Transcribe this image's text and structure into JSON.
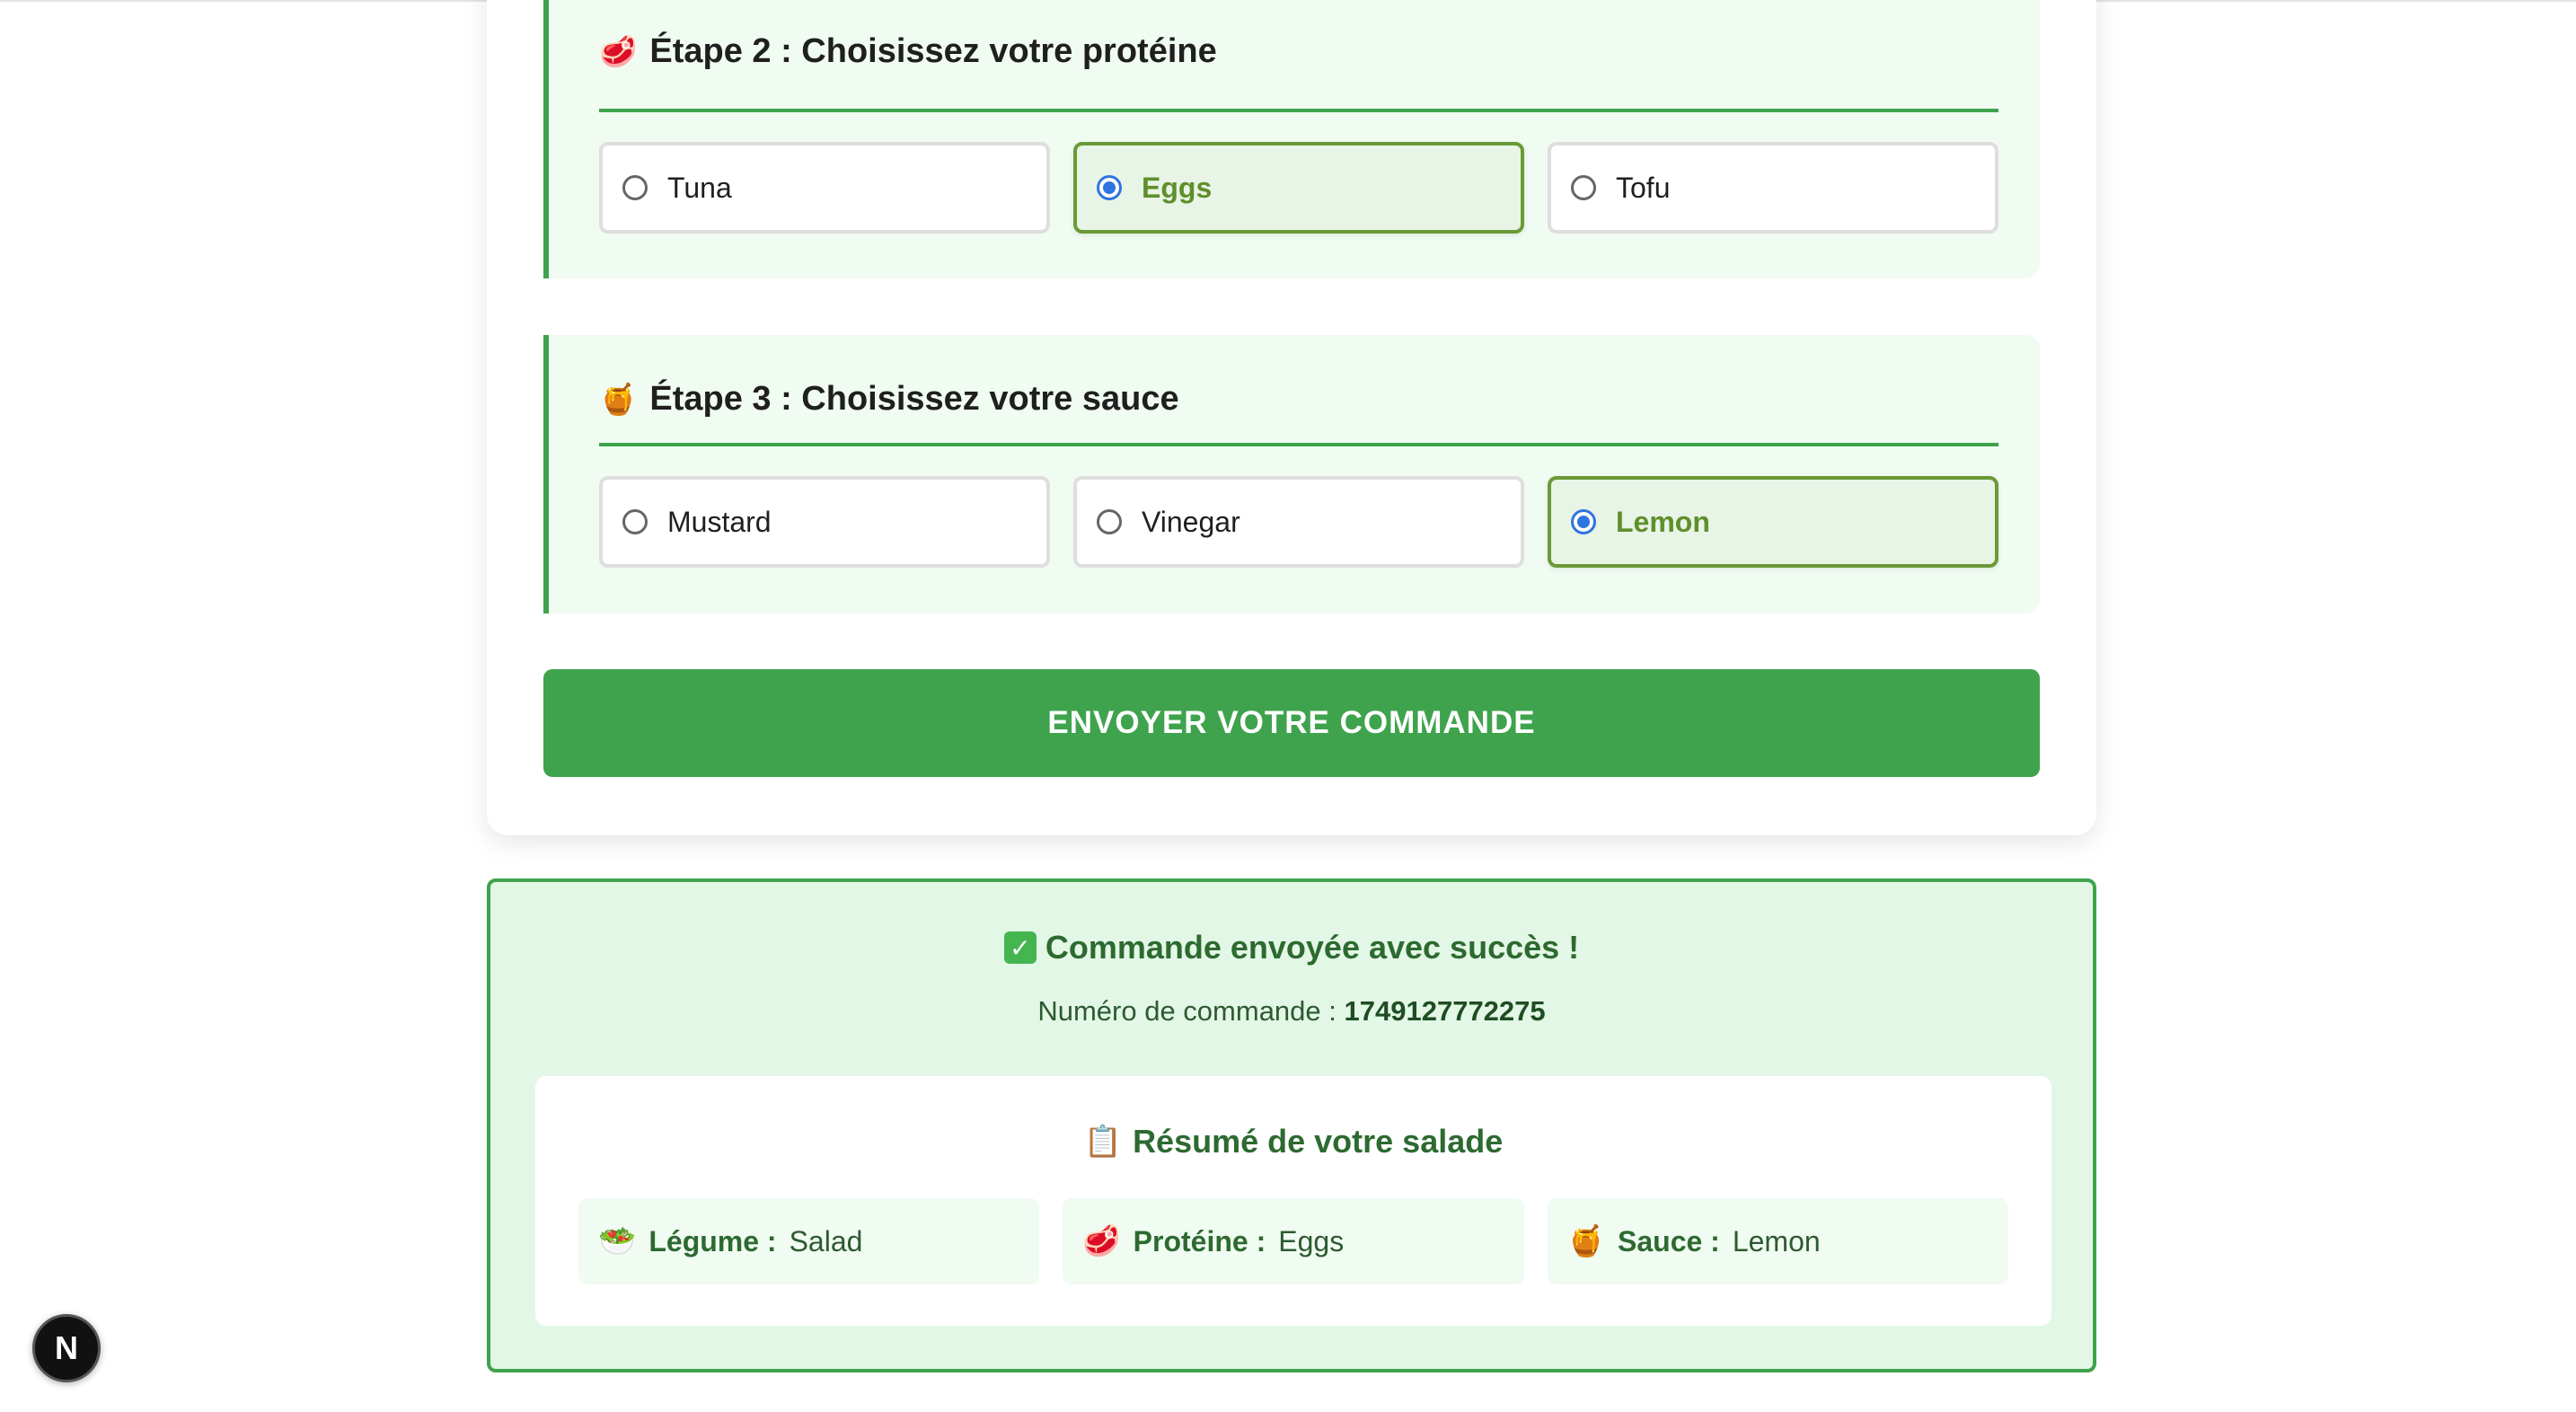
{
  "steps": [
    {
      "icon": "🥩",
      "icon_name": "meat-icon",
      "title": "Étape 2 : Choisissez votre protéine",
      "options": [
        "Tuna",
        "Eggs",
        "Tofu"
      ],
      "selected": "Eggs"
    },
    {
      "icon": "🍯",
      "icon_name": "honey-pot-icon",
      "title": "Étape 3 : Choisissez votre sauce",
      "options": [
        "Mustard",
        "Vinegar",
        "Lemon"
      ],
      "selected": "Lemon"
    }
  ],
  "submit_label": "ENVOYER VOTRE COMMANDE",
  "success": {
    "check_icon": "✓",
    "title": "Commande envoyée avec succès !",
    "order_prefix": "Numéro de commande :",
    "order_number": "1749127772275"
  },
  "summary": {
    "icon": "📋",
    "title": "Résumé de votre salade",
    "items": [
      {
        "icon": "🥗",
        "label": "Légume :",
        "value": "Salad"
      },
      {
        "icon": "🥩",
        "label": "Protéine :",
        "value": "Eggs"
      },
      {
        "icon": "🍯",
        "label": "Sauce :",
        "value": "Lemon"
      }
    ]
  },
  "dev_badge": "N",
  "colors": {
    "accent": "#3fa34d",
    "selected_text": "#5f8f2b",
    "radio": "#2f74e0"
  }
}
